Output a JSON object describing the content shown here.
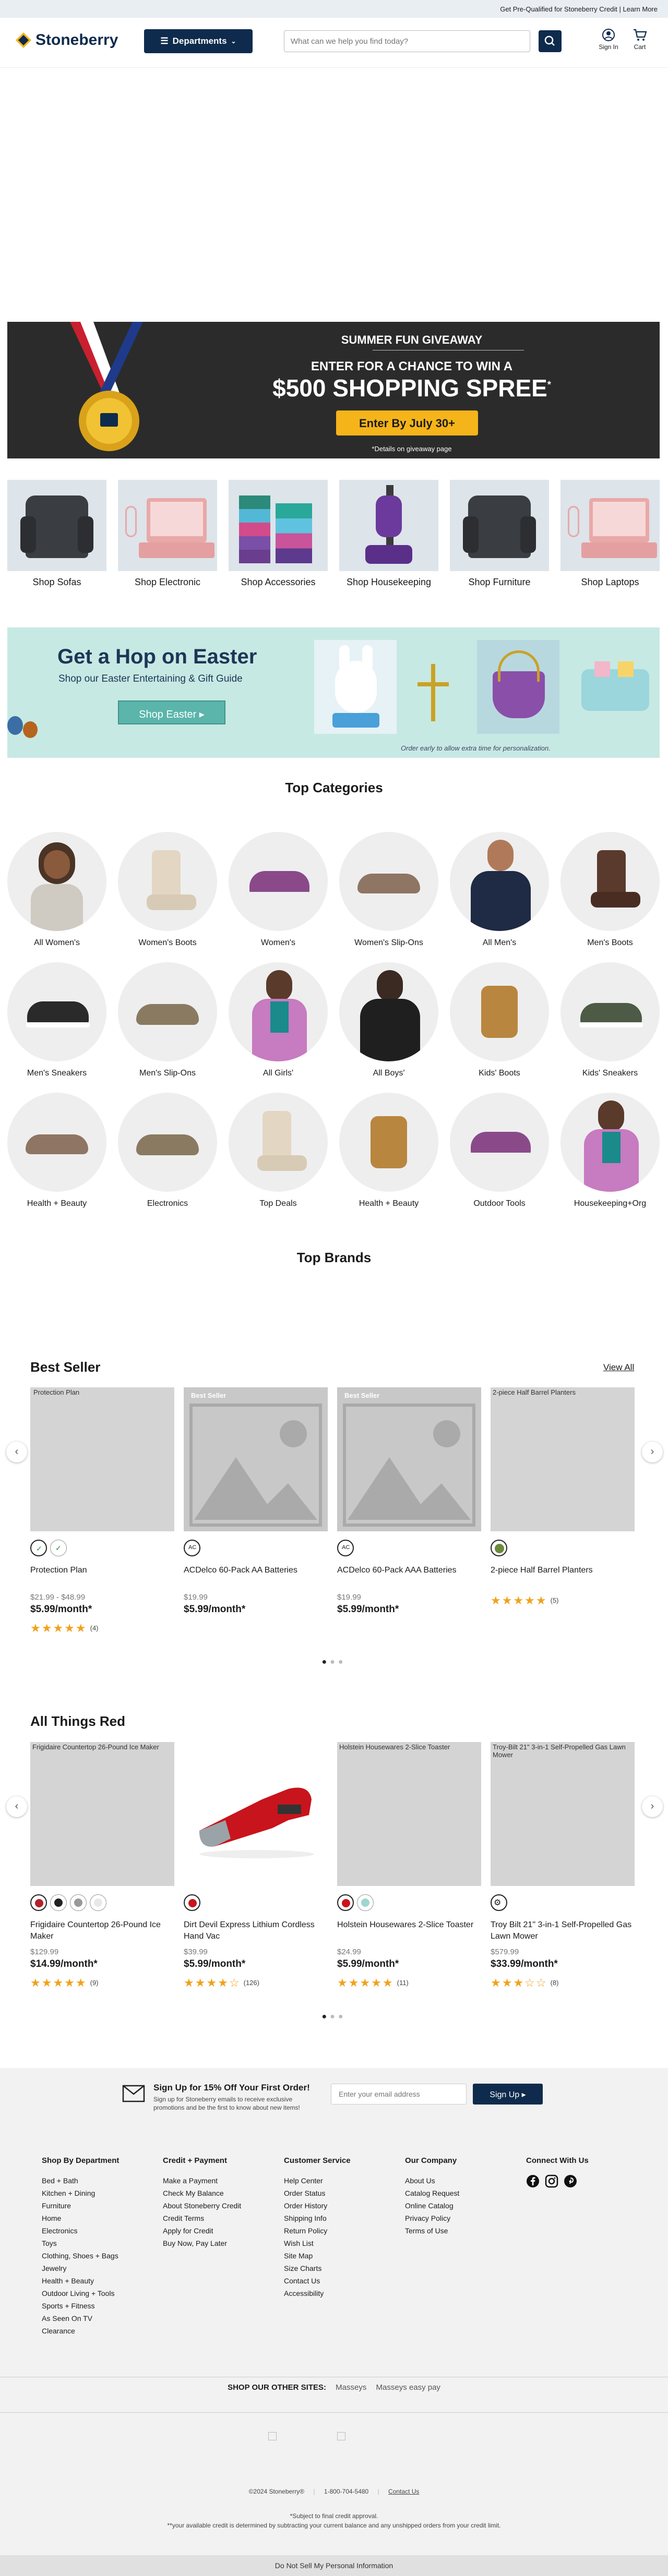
{
  "topbar": {
    "promo": "Get Pre-Qualified for Stoneberry Credit | Learn More"
  },
  "header": {
    "logo": "Stoneberry",
    "departments": "Departments",
    "search_placeholder": "What can we help you find today?",
    "signin": "Sign In",
    "cart": "Cart"
  },
  "giveaway": {
    "kicker": "SUMMER FUN GIVEAWAY",
    "line1": "ENTER FOR A CHANCE TO WIN A",
    "line2": "$500 SHOPPING SPREE",
    "sup": "*",
    "button": "Enter By July 30+",
    "footnote": "*Details on giveaway page"
  },
  "tiles": [
    {
      "label": "Shop Sofas"
    },
    {
      "label": "Shop Electronic"
    },
    {
      "label": "Shop Accessories"
    },
    {
      "label": "Shop Housekeeping"
    },
    {
      "label": "Shop Furniture"
    },
    {
      "label": "Shop Laptops"
    }
  ],
  "easter": {
    "title": "Get a Hop on Easter",
    "subtitle": "Shop our Easter Entertaining & Gift Guide",
    "button": "Shop Easter ▸",
    "note": "Order early to allow extra time for personalization."
  },
  "top_categories": {
    "title": "Top Categories",
    "items": [
      {
        "label": "All Women's"
      },
      {
        "label": "Women's Boots"
      },
      {
        "label": "Women's"
      },
      {
        "label": "Women's Slip-Ons"
      },
      {
        "label": "All Men's"
      },
      {
        "label": "Men's Boots"
      },
      {
        "label": "Men's Sneakers"
      },
      {
        "label": "Men's Slip-Ons"
      },
      {
        "label": "All Girls'"
      },
      {
        "label": "All Boys'"
      },
      {
        "label": "Kids' Boots"
      },
      {
        "label": "Kids' Sneakers"
      },
      {
        "label": "Health + Beauty"
      },
      {
        "label": "Electronics"
      },
      {
        "label": "Top Deals"
      },
      {
        "label": "Health + Beauty"
      },
      {
        "label": "Outdoor Tools"
      },
      {
        "label": "Housekeeping+Org"
      }
    ]
  },
  "top_brands": {
    "title": "Top Brands"
  },
  "best_seller": {
    "title": "Best Seller",
    "view_all": "View All",
    "products": [
      {
        "alt": "Protection Plan",
        "name": "Protection Plan",
        "price": "$21.99 - $48.99",
        "monthly": "$5.99/month*",
        "reviews": "(4)",
        "badge": ""
      },
      {
        "alt": "",
        "name": "ACDelco 60-Pack AA Batteries",
        "price": "$19.99",
        "monthly": "$5.99/month*",
        "reviews": "",
        "badge": "Best Seller"
      },
      {
        "alt": "",
        "name": "ACDelco 60-Pack AAA Batteries",
        "price": "$19.99",
        "monthly": "$5.99/month*",
        "reviews": "",
        "badge": "Best Seller"
      },
      {
        "alt": "2-piece Half Barrel Planters",
        "name": "2-piece Half Barrel Planters",
        "price": "",
        "monthly": "",
        "reviews": "(5)",
        "badge": ""
      }
    ]
  },
  "all_things_red": {
    "title": "All Things Red",
    "products": [
      {
        "alt": "Frigidaire Countertop 26-Pound Ice Maker",
        "name": "Frigidaire Countertop 26-Pound Ice Maker",
        "price": "$129.99",
        "monthly": "$14.99/month*",
        "reviews": "(9)"
      },
      {
        "alt": "",
        "name": "Dirt Devil Express Lithium Cordless Hand Vac",
        "price": "$39.99",
        "monthly": "$5.99/month*",
        "reviews": "(126)"
      },
      {
        "alt": "Holstein Housewares 2-Slice Toaster",
        "name": "Holstein Housewares 2-Slice Toaster",
        "price": "$24.99",
        "monthly": "$5.99/month*",
        "reviews": "(11)"
      },
      {
        "alt": "Troy-Bilt 21\" 3-in-1 Self-Propelled Gas Lawn Mower",
        "name": "Troy Bilt 21\" 3-in-1 Self-Propelled Gas Lawn Mower",
        "price": "$579.99",
        "monthly": "$33.99/month*",
        "reviews": "(8)"
      }
    ]
  },
  "signup": {
    "title": "Sign Up for 15% Off Your First Order!",
    "text": "Sign up for Stoneberry emails to receive exclusive promotions and be the first to know about new items!",
    "placeholder": "Enter your email address",
    "button": "Sign Up ▸"
  },
  "footer": {
    "col1": {
      "title": "Shop By Department",
      "links": [
        "Bed + Bath",
        "Kitchen + Dining",
        "Furniture",
        "Home",
        "Electronics",
        "Toys",
        "Clothing, Shoes + Bags",
        "Jewelry",
        "Health + Beauty",
        "Outdoor Living + Tools",
        "Sports + Fitness",
        "As Seen On TV",
        "Clearance"
      ]
    },
    "col2": {
      "title": "Credit + Payment",
      "links": [
        "Make a Payment",
        "Check My Balance",
        "About Stoneberry Credit",
        "Credit Terms",
        "Apply for Credit",
        "Buy Now, Pay Later"
      ]
    },
    "col3": {
      "title": "Customer Service",
      "links": [
        "Help Center",
        "Order Status",
        "Order History",
        "Shipping Info",
        "Return Policy",
        "Wish List",
        "Site Map",
        "Size Charts",
        "Contact Us",
        "Accessibility"
      ]
    },
    "col4": {
      "title": "Our Company",
      "links": [
        "About Us",
        "Catalog Request",
        "Online Catalog",
        "Privacy Policy",
        "Terms of Use"
      ]
    },
    "connect": "Connect With Us",
    "other_sites": "SHOP OUR OTHER SITES:",
    "site1": "Masseys",
    "site2": "Masseys easy pay",
    "copyright": "©2024 Stoneberry®",
    "phone": "1-800-704-5480",
    "contact": "Contact Us",
    "disclaimer1": "*Subject to final credit approval.",
    "disclaimer2": "**your available credit is determined by subtracting your current balance and any unshipped orders from your credit limit.",
    "do_not_sell": "Do Not Sell My Personal Information"
  },
  "colors": {
    "navy": "#0e2b4d",
    "gold": "#f5b41a",
    "teal": "#5bb5ab",
    "star": "#f0a21b"
  }
}
